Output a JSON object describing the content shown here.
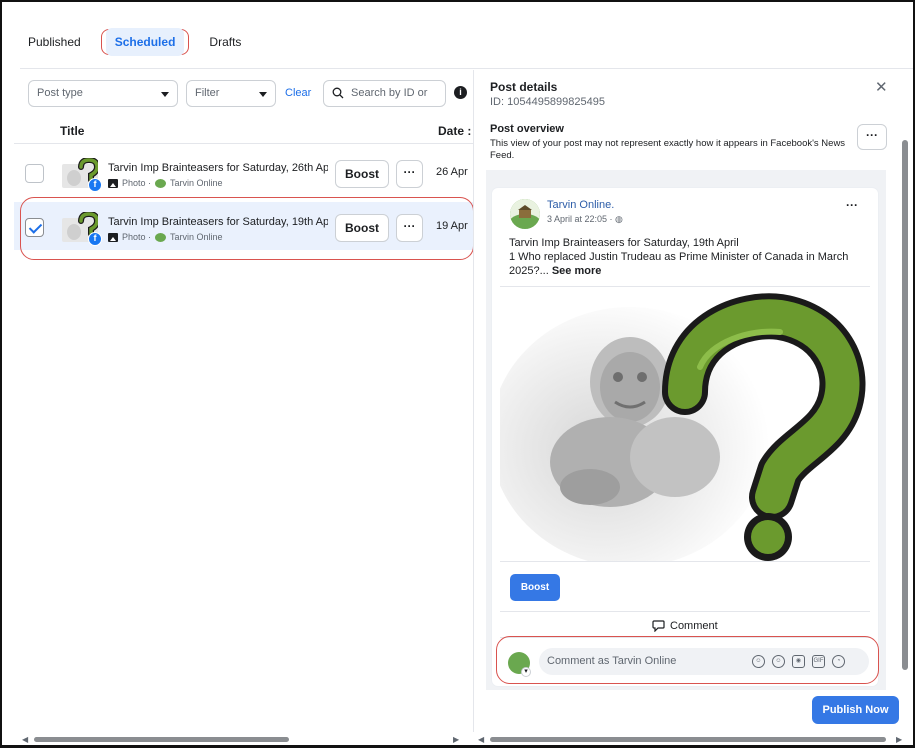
{
  "tabs": [
    {
      "label": "Published"
    },
    {
      "label": "Scheduled"
    },
    {
      "label": "Drafts"
    }
  ],
  "filters": {
    "post_type": "Post type",
    "filter": "Filter",
    "clear": "Clear",
    "search_placeholder": "Search by ID or"
  },
  "table": {
    "col_title": "Title",
    "col_date": "Date :",
    "rows": [
      {
        "title": "Tarvin Imp Brainteasers for Saturday, 26th Ap...",
        "type": "Photo ·",
        "page": "Tarvin Online",
        "boost": "Boost",
        "more": "···",
        "date": "26 Apr",
        "checked": false
      },
      {
        "title": "Tarvin Imp Brainteasers for Saturday, 19th Ap...",
        "type": "Photo ·",
        "page": "Tarvin Online",
        "boost": "Boost",
        "more": "···",
        "date": "19 Apr",
        "checked": true
      }
    ]
  },
  "details": {
    "title": "Post details",
    "id": "ID: 1054495899825495",
    "overview_title": "Post overview",
    "overview_desc": "This view of your post may not represent exactly how it appears in Facebook's News Feed.",
    "more": "···"
  },
  "post": {
    "page_name": "Tarvin Online.",
    "time": "3 April at 22:05 · ",
    "line1": "Tarvin Imp Brainteasers for Saturday, 19th April",
    "line2": "1 Who replaced Justin Trudeau as Prime Minister of Canada in March 2025?... ",
    "see_more": "See more",
    "more": "···",
    "boost": "Boost",
    "comment": "Comment",
    "comment_placeholder": "Comment as Tarvin Online"
  },
  "actions": {
    "publish": "Publish Now"
  },
  "colors": {
    "accent": "#3578e5",
    "highlight_ring": "#d9534f",
    "selected_row": "#eaf1fd",
    "question_mark": "#6b9a2e"
  }
}
